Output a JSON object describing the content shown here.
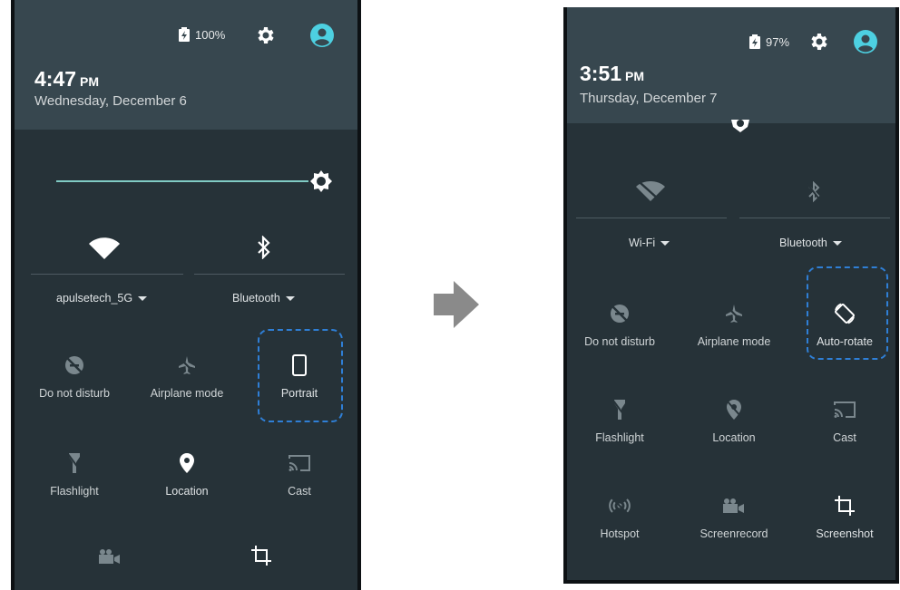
{
  "left": {
    "battery": "100%",
    "time": "4:47",
    "ampm": "PM",
    "date": "Wednesday, December 6",
    "wifi_label": "apulsetech_5G",
    "bluetooth_label": "Bluetooth",
    "tiles": [
      {
        "label": "Do not disturb"
      },
      {
        "label": "Airplane mode"
      },
      {
        "label": "Portrait"
      },
      {
        "label": "Flashlight"
      },
      {
        "label": "Location"
      },
      {
        "label": "Cast"
      }
    ],
    "colors": {
      "accent": "#4dd0e1",
      "slider_track": "#80cbc4"
    }
  },
  "right": {
    "battery": "97%",
    "time": "3:51",
    "ampm": "PM",
    "date": "Thursday, December 7",
    "wifi_label": "Wi-Fi",
    "bluetooth_label": "Bluetooth",
    "tiles": [
      {
        "label": "Do not disturb"
      },
      {
        "label": "Airplane mode"
      },
      {
        "label": "Auto-rotate"
      },
      {
        "label": "Flashlight"
      },
      {
        "label": "Location"
      },
      {
        "label": "Cast"
      },
      {
        "label": "Hotspot"
      },
      {
        "label": "Screenrecord"
      },
      {
        "label": "Screenshot"
      }
    ]
  },
  "highlight_color": "#2f7fd6",
  "arrow_color": "#8a8a8a"
}
